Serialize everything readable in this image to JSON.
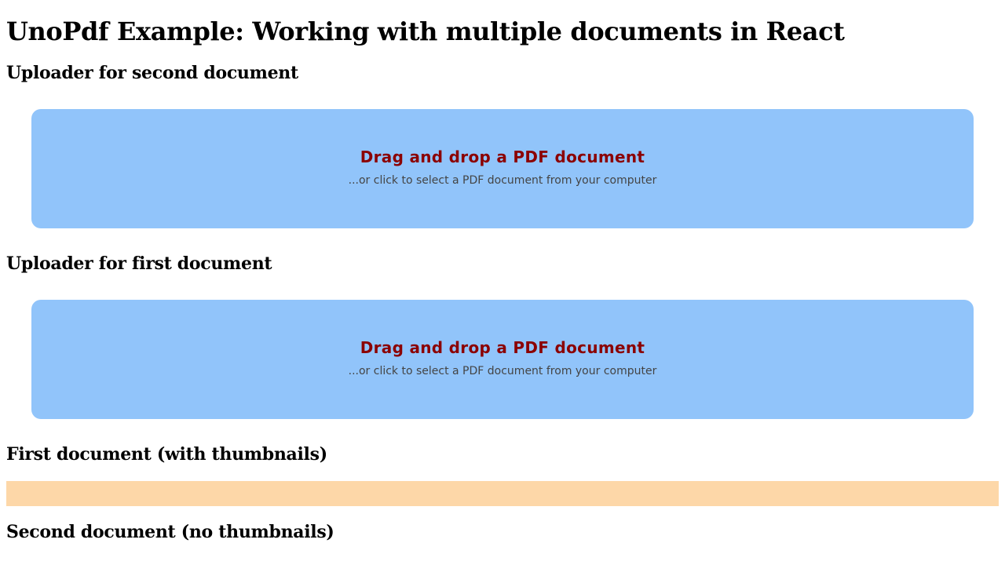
{
  "page": {
    "title": "UnoPdf Example: Working with multiple documents in React"
  },
  "uploaders": {
    "second": {
      "heading": "Uploader for second document",
      "dropzone_title": "Drag and drop a PDF document",
      "dropzone_subtitle": "...or click to select a PDF document from your computer"
    },
    "first": {
      "heading": "Uploader for first document",
      "dropzone_title": "Drag and drop a PDF document",
      "dropzone_subtitle": "...or click to select a PDF document from your computer"
    }
  },
  "documents": {
    "first": {
      "heading": "First document (with thumbnails)"
    },
    "second": {
      "heading": "Second document (no thumbnails)"
    }
  },
  "colors": {
    "dropzone_background": "#91c4fa",
    "dropzone_title": "#8b0000",
    "dropzone_subtitle": "#444444",
    "thumbnail_strip": "#fdd7a8"
  }
}
